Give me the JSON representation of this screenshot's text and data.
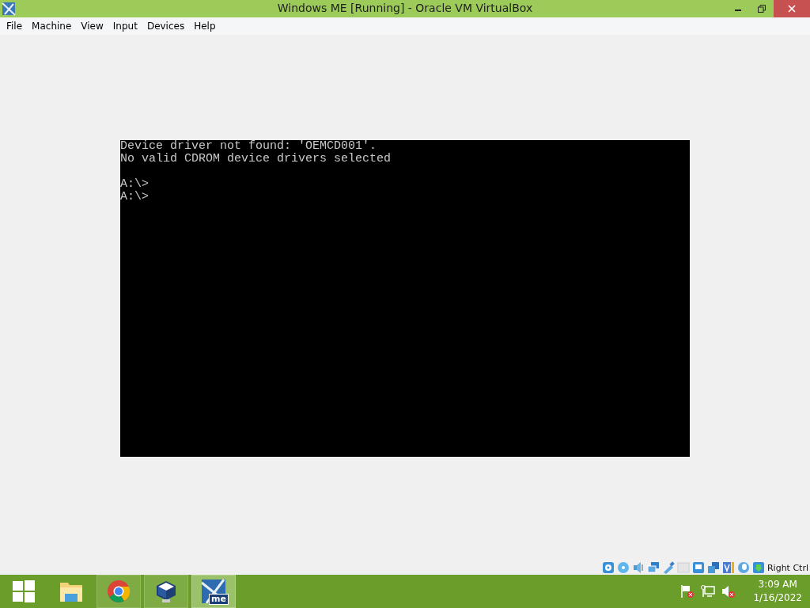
{
  "window": {
    "title": "Windows ME [Running] - Oracle VM VirtualBox"
  },
  "menu": [
    "File",
    "Machine",
    "View",
    "Input",
    "Devices",
    "Help"
  ],
  "console": {
    "blocks": [
      [
        "Device driver not found: 'OEMCD001'.",
        "No valid CDROM device drivers selected"
      ],
      [
        "A:\\>",
        "A:\\>"
      ]
    ]
  },
  "status_bar": {
    "host_key": "Right Ctrl"
  },
  "taskbar": {
    "items": [
      {
        "kind": "start",
        "selected": false,
        "open": false
      },
      {
        "kind": "explorer",
        "selected": false,
        "open": false
      },
      {
        "kind": "chrome",
        "selected": false,
        "open": true
      },
      {
        "kind": "virtualbox",
        "selected": false,
        "open": true
      },
      {
        "kind": "vm",
        "selected": true,
        "open": true,
        "label": "me"
      }
    ],
    "clock": {
      "time": "3:09 AM",
      "date": "1/16/2022"
    }
  }
}
